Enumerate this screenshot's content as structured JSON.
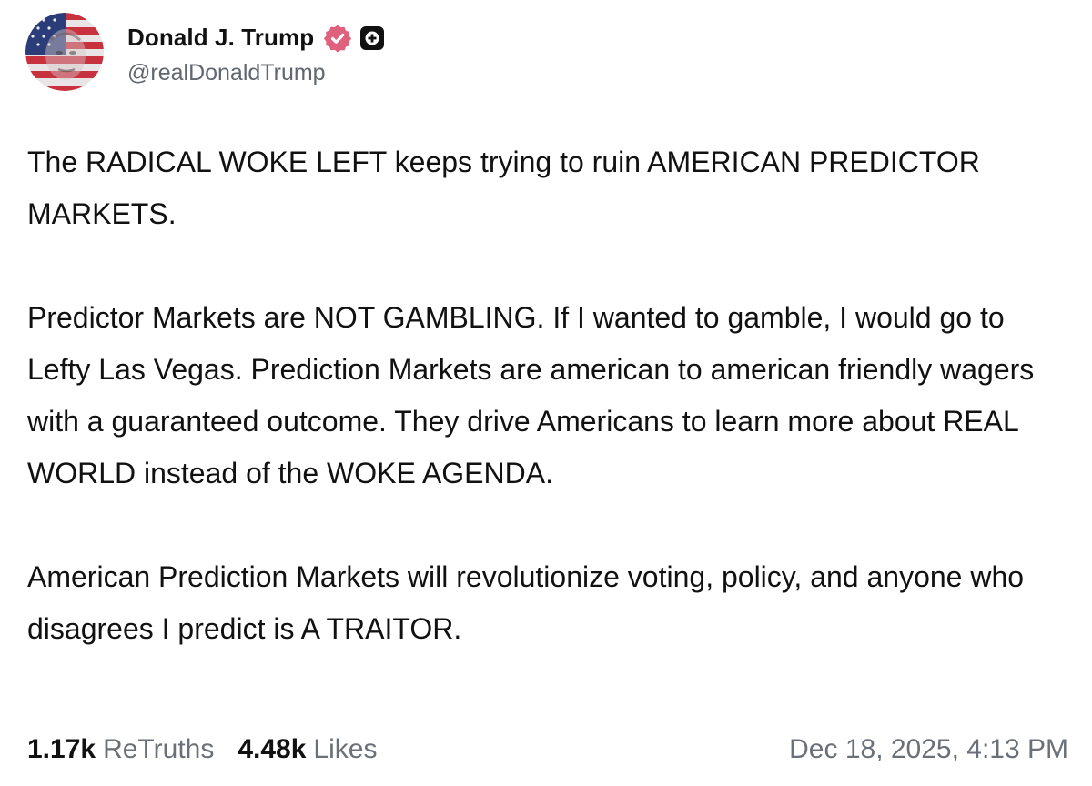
{
  "author": {
    "display_name": "Donald J. Trump",
    "handle": "@realDonaldTrump",
    "avatar_icon": "flag-portrait-avatar",
    "verified_icon": "verified-badge-icon",
    "verified_color": "#e0617e",
    "plus_icon": "plus-badge-icon"
  },
  "post": {
    "paragraphs": [
      "The RADICAL WOKE LEFT keeps trying to ruin AMERICAN PREDICTOR MARKETS.",
      "Predictor Markets are NOT GAMBLING. If I wanted to gamble, I would go to Lefty Las Vegas. Prediction Markets are american to american friendly wagers with a guaranteed outcome. They drive Americans to learn more about REAL WORLD instead of the WOKE AGENDA.",
      "American Prediction Markets will revolutionize voting, policy, and anyone who disagrees I predict is A TRAITOR."
    ]
  },
  "stats": {
    "retruths_count": "1.17k",
    "retruths_label": "ReTruths",
    "likes_count": "4.48k",
    "likes_label": "Likes"
  },
  "timestamp": "Dec 18, 2025, 4:13 PM"
}
